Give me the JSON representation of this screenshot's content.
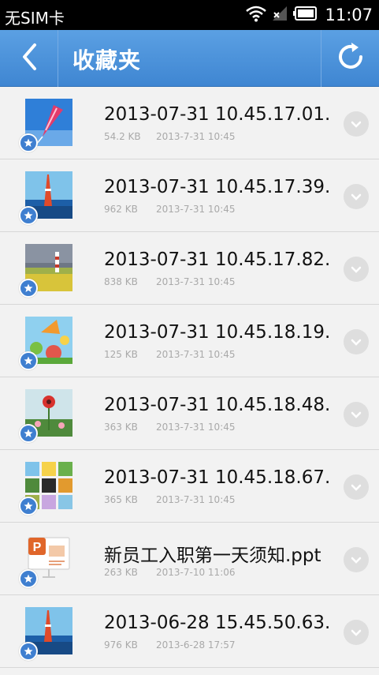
{
  "status": {
    "carrier": "无SIM卡",
    "time": "11:07"
  },
  "app_bar": {
    "title": "收藏夹"
  },
  "files": [
    {
      "name": "2013-07-31 10.45.17.01.",
      "size": "54.2 KB",
      "date": "2013-7-31 10:45",
      "thumb": "kite-photo"
    },
    {
      "name": "2013-07-31 10.45.17.39.",
      "size": "962 KB",
      "date": "2013-7-31 10:45",
      "thumb": "tower-photo"
    },
    {
      "name": "2013-07-31 10.45.17.82.",
      "size": "838 KB",
      "date": "2013-7-31 10:45",
      "thumb": "lighthouse-photo"
    },
    {
      "name": "2013-07-31 10.45.18.19.",
      "size": "125 KB",
      "date": "2013-7-31 10:45",
      "thumb": "illustration-photo"
    },
    {
      "name": "2013-07-31 10.45.18.48.",
      "size": "363 KB",
      "date": "2013-7-31 10:45",
      "thumb": "flower-photo"
    },
    {
      "name": "2013-07-31 10.45.18.67.",
      "size": "365 KB",
      "date": "2013-7-31 10:45",
      "thumb": "collage-photo"
    },
    {
      "name": "新员工入职第一天须知.ppt",
      "size": "263 KB",
      "date": "2013-7-10 11:06",
      "thumb": "ppt-file-icon"
    },
    {
      "name": "2013-06-28 15.45.50.63.",
      "size": "976 KB",
      "date": "2013-6-28 17:57",
      "thumb": "tower-photo"
    }
  ],
  "icons": {
    "back": "chevron-left-icon",
    "refresh": "refresh-icon",
    "favorite": "star-icon",
    "expand": "chevron-down-icon"
  },
  "colors": {
    "app_bar": "#4a91db",
    "badge": "#3f7fd0"
  }
}
